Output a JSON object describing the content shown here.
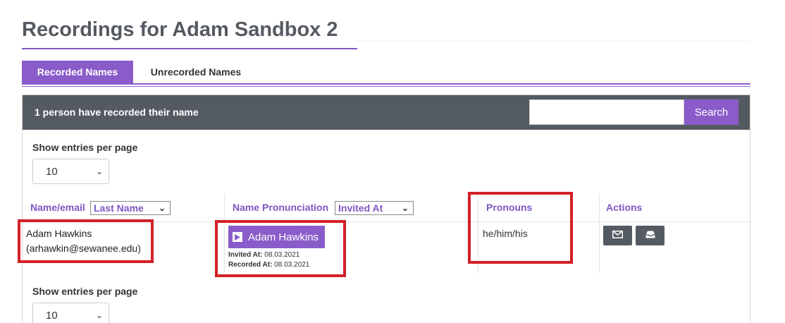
{
  "page": {
    "title": "Recordings for Adam Sandbox 2"
  },
  "tabs": [
    {
      "label": "Recorded Names",
      "active": true
    },
    {
      "label": "Unrecorded Names",
      "active": false
    }
  ],
  "panel": {
    "header_text": "1 person have recorded their name",
    "search": {
      "value": "",
      "placeholder": "",
      "button_label": "Search"
    }
  },
  "entries": {
    "label": "Show entries per page",
    "selected": "10"
  },
  "table": {
    "columns": {
      "name_email": "Name/email",
      "name_sort": "Last Name",
      "pronunciation": "Name Pronunciation",
      "pronunciation_sort": "Invited At",
      "pronouns": "Pronouns",
      "actions": "Actions"
    },
    "rows": [
      {
        "name": "Adam Hawkins",
        "email": "(arhawkin@sewanee.edu)",
        "play_label": "Adam Hawkins",
        "invited_label": "Invited At:",
        "invited_value": "08.03.2021",
        "recorded_label": "Recorded At:",
        "recorded_value": "08.03.2021",
        "pronouns": "he/him/his",
        "actions": [
          "envelope-icon",
          "inbox-icon"
        ]
      }
    ]
  },
  "colors": {
    "accent": "#8a5cc9",
    "header_bg": "#545a62",
    "highlight": "#d32027",
    "title": "#555a61"
  }
}
